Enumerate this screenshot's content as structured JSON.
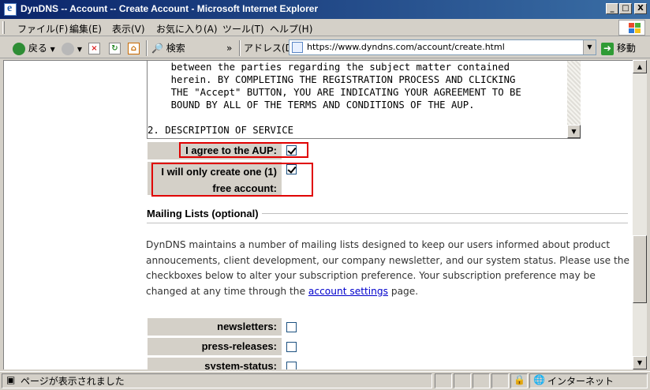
{
  "window": {
    "title": "DynDNS -- Account -- Create Account - Microsoft Internet Explorer",
    "min_glyph": "_",
    "max_glyph": "□",
    "close_glyph": "X"
  },
  "menu": [
    "ファイル(F)",
    "編集(E)",
    "表示(V)",
    "お気に入り(A)",
    "ツール(T)",
    "ヘルプ(H)"
  ],
  "toolbar": {
    "back_label": "戻る",
    "search_label": "検索",
    "chevron": "»",
    "address_label": "アドレス(D)",
    "url": "https://www.dyndns.com/account/create.html",
    "go_label": "移動"
  },
  "aup": {
    "text": "    between the parties regarding the subject matter contained\n    herein. BY COMPLETING THE REGISTRATION PROCESS AND CLICKING\n    THE \"Accept\" BUTTON, YOU ARE INDICATING YOUR AGREEMENT TO BE\n    BOUND BY ALL OF THE TERMS AND CONDITIONS OF THE AUP.\n\n2. DESCRIPTION OF SERVICE"
  },
  "agreements": {
    "aup_label": "I agree to the AUP:",
    "aup_checked": true,
    "one_account_label_1": "I will only create one (1)",
    "one_account_label_2": "free account:",
    "one_account_checked": true
  },
  "mailing": {
    "title": "Mailing Lists (optional)",
    "para_before_link": "DynDNS maintains a number of mailing lists designed to keep our users informed about product annoucements, client development, our company newsletter, and our system status. Please use the checkboxes below to alter your subscription preference. Your subscription preference may be changed at any time through the ",
    "link_text": "account settings",
    "para_after_link": " page.",
    "lists": [
      {
        "label": "newsletters:",
        "checked": false
      },
      {
        "label": "press-releases:",
        "checked": false
      },
      {
        "label": "system-status:",
        "checked": false
      }
    ]
  },
  "status": {
    "message": "ページが表示されました",
    "zone": "インターネット"
  }
}
